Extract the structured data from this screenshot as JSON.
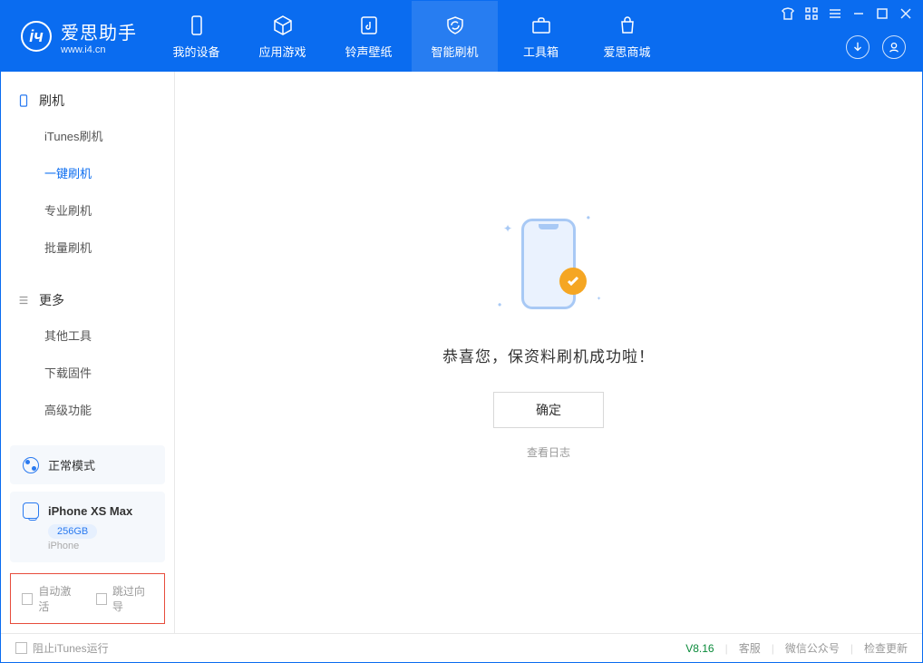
{
  "app": {
    "title": "爱思助手",
    "subtitle": "www.i4.cn"
  },
  "nav": {
    "device": "我的设备",
    "apps": "应用游戏",
    "ringtone": "铃声壁纸",
    "flash": "智能刷机",
    "toolbox": "工具箱",
    "store": "爱思商城"
  },
  "sidebar": {
    "section_flash": "刷机",
    "items_flash": {
      "itunes": "iTunes刷机",
      "oneclick": "一键刷机",
      "pro": "专业刷机",
      "batch": "批量刷机"
    },
    "section_more": "更多",
    "items_more": {
      "other": "其他工具",
      "download": "下载固件",
      "advanced": "高级功能"
    }
  },
  "mode_card": {
    "label": "正常模式"
  },
  "device_card": {
    "name": "iPhone XS Max",
    "capacity": "256GB",
    "type": "iPhone"
  },
  "checks": {
    "auto_activate": "自动激活",
    "skip_guide": "跳过向导"
  },
  "main": {
    "success": "恭喜您，保资料刷机成功啦！",
    "ok": "确定",
    "log": "查看日志"
  },
  "footer": {
    "block_itunes": "阻止iTunes运行",
    "version": "V8.16",
    "support": "客服",
    "wechat": "微信公众号",
    "update": "检查更新"
  }
}
